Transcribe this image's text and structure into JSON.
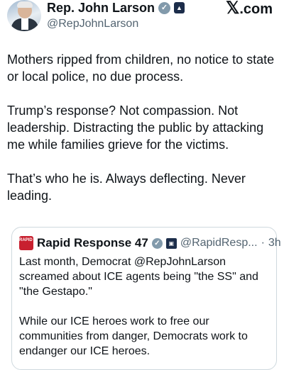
{
  "author": {
    "name": "Rep. John Larson",
    "handle": "@RepJohnLarson",
    "verified_glyph": "✓",
    "affiliation_glyph": "▲"
  },
  "brand": {
    "x_mark": "𝕏",
    "label": ".com"
  },
  "post": {
    "text": "Mothers ripped from children, no notice to state or local police, no due process.\n\nTrump’s response? Not compassion. Not leadership. Distracting the public by attacking me while families grieve for the victims.\n\nThat’s who he is. Always deflecting. Never leading."
  },
  "quoted": {
    "logo_text": "RAPID RESPONSE",
    "name": "Rapid Response 47",
    "verified_glyph": "✓",
    "affiliation_glyph": "▣",
    "handle": "@RapidResp...",
    "separator": "·",
    "time": "3h",
    "text": "Last month, Democrat @RepJohnLarson screamed about ICE agents being \"the SS\" and \"the Gestapo.\"\n\nWhile our ICE heroes work to free our communities from danger, Democrats work to endanger our ICE heroes."
  },
  "colors": {
    "text": "#0f1419",
    "secondary": "#536471",
    "border": "#cfd9de",
    "quote_logo": "#c8202f"
  },
  "icons": [
    "avatar",
    "verified-badge-icon",
    "government-affiliation-icon",
    "x-logo-icon",
    "rapid-response-logo-icon"
  ]
}
